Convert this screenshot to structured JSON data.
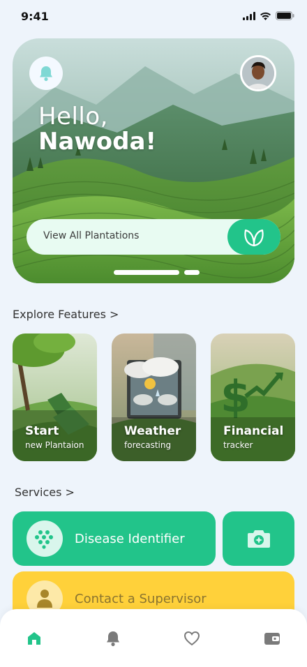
{
  "status_bar": {
    "time": "9:41"
  },
  "hero": {
    "greeting_line1": "Hello,",
    "greeting_line2": "Nawoda!",
    "plantations_label": "View All Plantations"
  },
  "explore": {
    "title": "Explore Features >",
    "cards": [
      {
        "title": "Start",
        "subtitle": "new Plantaion"
      },
      {
        "title": "Weather",
        "subtitle": "forecasting"
      },
      {
        "title": "Financial",
        "subtitle": "tracker"
      }
    ]
  },
  "services": {
    "title": "Services >",
    "disease_label": "Disease Identifier",
    "contact_label": "Contact a Supervisor"
  },
  "colors": {
    "accent": "#22c48a",
    "accent_light": "#e8fbf2",
    "contact": "#ffd13a",
    "background": "#eef4fb"
  },
  "icons": {
    "hero": [
      "bell-icon",
      "leaf-icon"
    ],
    "services": [
      "virus-icon",
      "camera-icon",
      "person-icon"
    ],
    "nav": [
      "home-icon",
      "bell-icon",
      "heart-icon",
      "wallet-icon"
    ]
  }
}
